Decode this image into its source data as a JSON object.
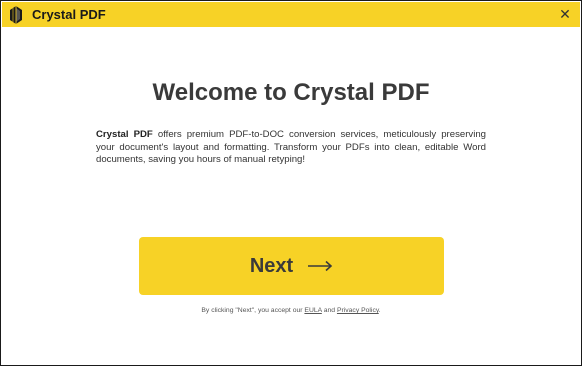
{
  "window": {
    "title": "Crystal PDF",
    "close_icon": "✕"
  },
  "main": {
    "heading": "Welcome to Crystal PDF",
    "description_brand": "Crystal PDF",
    "description_text": " offers premium PDF-to-DOC conversion services, meticulously preserving your document's layout and formatting. Transform your PDFs into clean, editable Word documents, saving you hours of manual retyping!"
  },
  "next_button": {
    "label": "Next",
    "arrow_icon": "arrow-right-icon"
  },
  "consent": {
    "prefix": "By clicking \"Next\", you accept our ",
    "eula_link": "EULA",
    "and": " and ",
    "privacy_link": "Privacy Policy",
    "suffix": "."
  },
  "colors": {
    "accent": "#f7d226",
    "heading": "#3a3a3a",
    "text": "#333333"
  }
}
